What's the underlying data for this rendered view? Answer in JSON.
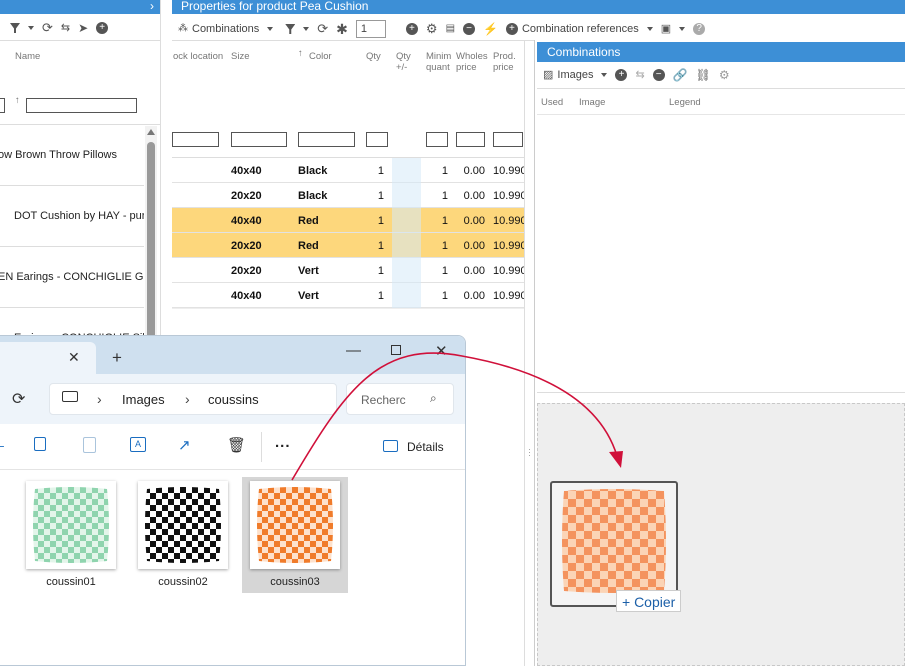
{
  "left_panel": {
    "column_name": "Name",
    "items": [
      "ow Brown Throw Pillows",
      "DOT Cushion by HAY - pure",
      "EN Earings - CONCHIGLIE Gol",
      "Earings - CONCHIGLIE Sil"
    ]
  },
  "properties": {
    "title": "Properties for product Pea Cushion",
    "toolbar": {
      "combinations_label": "Combinations",
      "qty_value": "1",
      "references_label": "Combination references"
    },
    "columns": [
      "ock location",
      "Size",
      "Color",
      "Qty",
      "Qty +/-",
      "Minim quant",
      "Wholes price",
      "Prod. price"
    ],
    "rows": [
      {
        "size": "40x40",
        "color": "Black",
        "qty": "1",
        "min": "1",
        "wholesale": "0.00",
        "price": "10.990",
        "highlighted": false
      },
      {
        "size": "20x20",
        "color": "Black",
        "qty": "1",
        "min": "1",
        "wholesale": "0.00",
        "price": "10.990",
        "highlighted": false
      },
      {
        "size": "40x40",
        "color": "Red",
        "qty": "1",
        "min": "1",
        "wholesale": "0.00",
        "price": "10.990",
        "highlighted": true
      },
      {
        "size": "20x20",
        "color": "Red",
        "qty": "1",
        "min": "1",
        "wholesale": "0.00",
        "price": "10.990",
        "highlighted": true
      },
      {
        "size": "20x20",
        "color": "Vert",
        "qty": "1",
        "min": "1",
        "wholesale": "0.00",
        "price": "10.990",
        "highlighted": false
      },
      {
        "size": "40x40",
        "color": "Vert",
        "qty": "1",
        "min": "1",
        "wholesale": "0.00",
        "price": "10.990",
        "highlighted": false
      }
    ]
  },
  "combinations_panel": {
    "title": "Combinations",
    "images_label": "Images",
    "columns": [
      "Used",
      "Image",
      "Legend"
    ]
  },
  "explorer": {
    "breadcrumb": [
      "Images",
      "coussins"
    ],
    "search_placeholder": "Recherc",
    "details_label": "Détails",
    "more_label": "...",
    "files": [
      {
        "name": "coussin01",
        "color": "#8fd4ae",
        "selected": false
      },
      {
        "name": "coussin02",
        "color": "#111111",
        "selected": false
      },
      {
        "name": "coussin03",
        "color": "#f07b2a",
        "selected": true
      }
    ]
  },
  "drag": {
    "copy_label": "+ Copier",
    "arrow_color": "#d0103a"
  }
}
